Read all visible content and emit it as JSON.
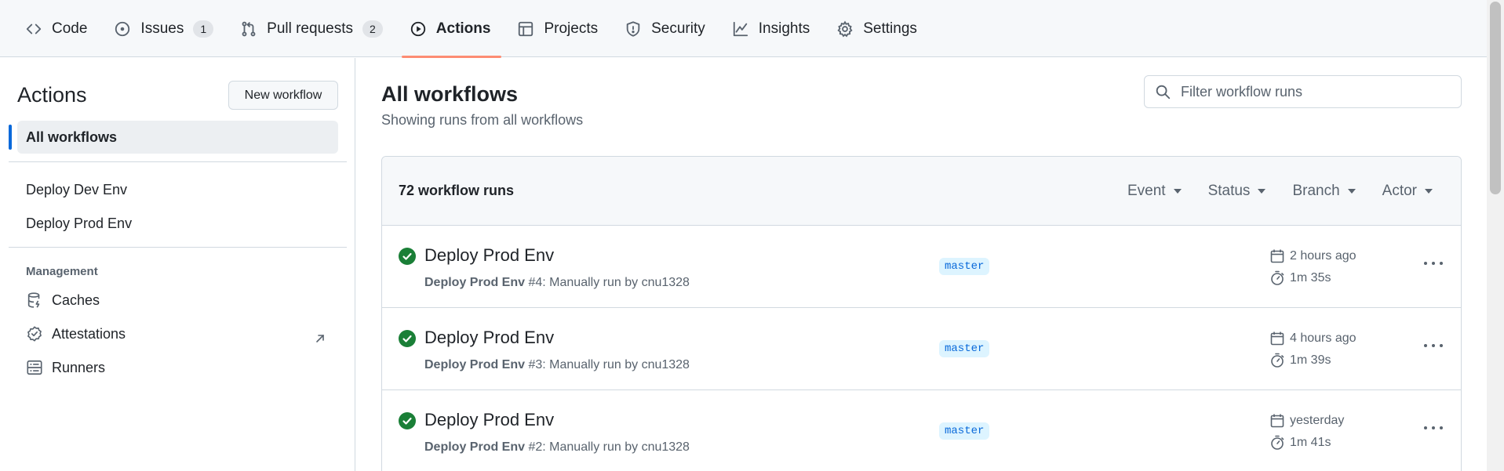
{
  "nav": {
    "tabs": [
      {
        "label": "Code",
        "icon": "code-icon"
      },
      {
        "label": "Issues",
        "count": "1",
        "icon": "issue-icon"
      },
      {
        "label": "Pull requests",
        "count": "2",
        "icon": "pull-request-icon"
      },
      {
        "label": "Actions",
        "icon": "play-icon",
        "active": true
      },
      {
        "label": "Projects",
        "icon": "table-icon"
      },
      {
        "label": "Security",
        "icon": "shield-icon"
      },
      {
        "label": "Insights",
        "icon": "graph-icon"
      },
      {
        "label": "Settings",
        "icon": "gear-icon"
      }
    ],
    "active_color": "#fd8c73"
  },
  "sidebar": {
    "title": "Actions",
    "new_workflow_label": "New workflow",
    "active_item": "All workflows",
    "workflows": [
      "Deploy Dev Env",
      "Deploy Prod Env"
    ],
    "management_heading": "Management",
    "management_items": [
      {
        "label": "Caches",
        "icon": "database-icon"
      },
      {
        "label": "Attestations",
        "icon": "verified-icon",
        "external": true
      },
      {
        "label": "Runners",
        "icon": "server-icon"
      }
    ]
  },
  "main": {
    "title": "All workflows",
    "subtitle": "Showing runs from all workflows",
    "search_placeholder": "Filter workflow runs",
    "runs_count": "72 workflow runs",
    "filters": [
      "Event",
      "Status",
      "Branch",
      "Actor"
    ],
    "runs": [
      {
        "title": "Deploy Prod Env",
        "workflow": "Deploy Prod Env",
        "detail": "#4: Manually run by cnu1328",
        "branch": "master",
        "when": "2 hours ago",
        "duration": "1m 35s",
        "status": "success"
      },
      {
        "title": "Deploy Prod Env",
        "workflow": "Deploy Prod Env",
        "detail": "#3: Manually run by cnu1328",
        "branch": "master",
        "when": "4 hours ago",
        "duration": "1m 39s",
        "status": "success"
      },
      {
        "title": "Deploy Prod Env",
        "workflow": "Deploy Prod Env",
        "detail": "#2: Manually run by cnu1328",
        "branch": "master",
        "when": "yesterday",
        "duration": "1m 41s",
        "status": "success"
      }
    ]
  },
  "colors": {
    "success": "#1a7f37",
    "accent": "#0969da",
    "border": "#d1d9e0",
    "muted": "#59636e"
  }
}
